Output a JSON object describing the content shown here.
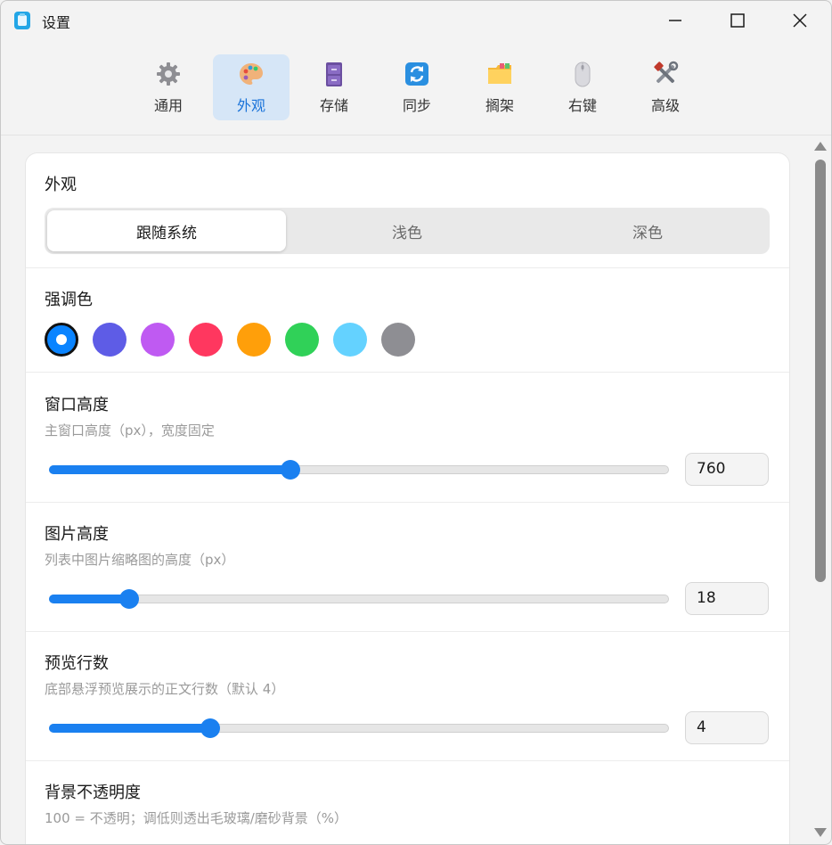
{
  "window": {
    "title": "设置",
    "controls": [
      "minimize-icon",
      "maximize-icon",
      "close-icon"
    ]
  },
  "tabs": [
    {
      "label": "通用",
      "icon": "gear-icon",
      "active": false
    },
    {
      "label": "外观",
      "icon": "palette-icon",
      "active": true
    },
    {
      "label": "存储",
      "icon": "cabinet-icon",
      "active": false
    },
    {
      "label": "同步",
      "icon": "sync-icon",
      "active": false
    },
    {
      "label": "搁架",
      "icon": "folder-icon",
      "active": false
    },
    {
      "label": "右键",
      "icon": "mouse-icon",
      "active": false
    },
    {
      "label": "高级",
      "icon": "tools-icon",
      "active": false
    }
  ],
  "appearance": {
    "title": "外观",
    "options": [
      "跟随系统",
      "浅色",
      "深色"
    ],
    "selected": "跟随系统"
  },
  "accent": {
    "title": "强调色",
    "colors": [
      "#0a84ff",
      "#5e5ce6",
      "#bf5af2",
      "#ff375f",
      "#ff9f0a",
      "#30d158",
      "#64d2ff",
      "#8e8e93"
    ],
    "selected_index": 0
  },
  "window_height": {
    "title": "窗口高度",
    "desc": "主窗口高度（px），宽度固定",
    "value": "760",
    "slider_fraction": 0.39
  },
  "image_height": {
    "title": "图片高度",
    "desc": "列表中图片缩略图的高度（px）",
    "value": "18",
    "slider_fraction": 0.13
  },
  "preview_lines": {
    "title": "预览行数",
    "desc": "底部悬浮预览展示的正文行数（默认 4）",
    "value": "4",
    "slider_fraction": 0.26
  },
  "opacity": {
    "title": "背景不透明度",
    "desc": "100 = 不透明；调低则透出毛玻璃/磨砂背景（%）"
  },
  "colors": {
    "accent": "#1a80f0",
    "active_tab_bg": "#d6e6f7"
  }
}
